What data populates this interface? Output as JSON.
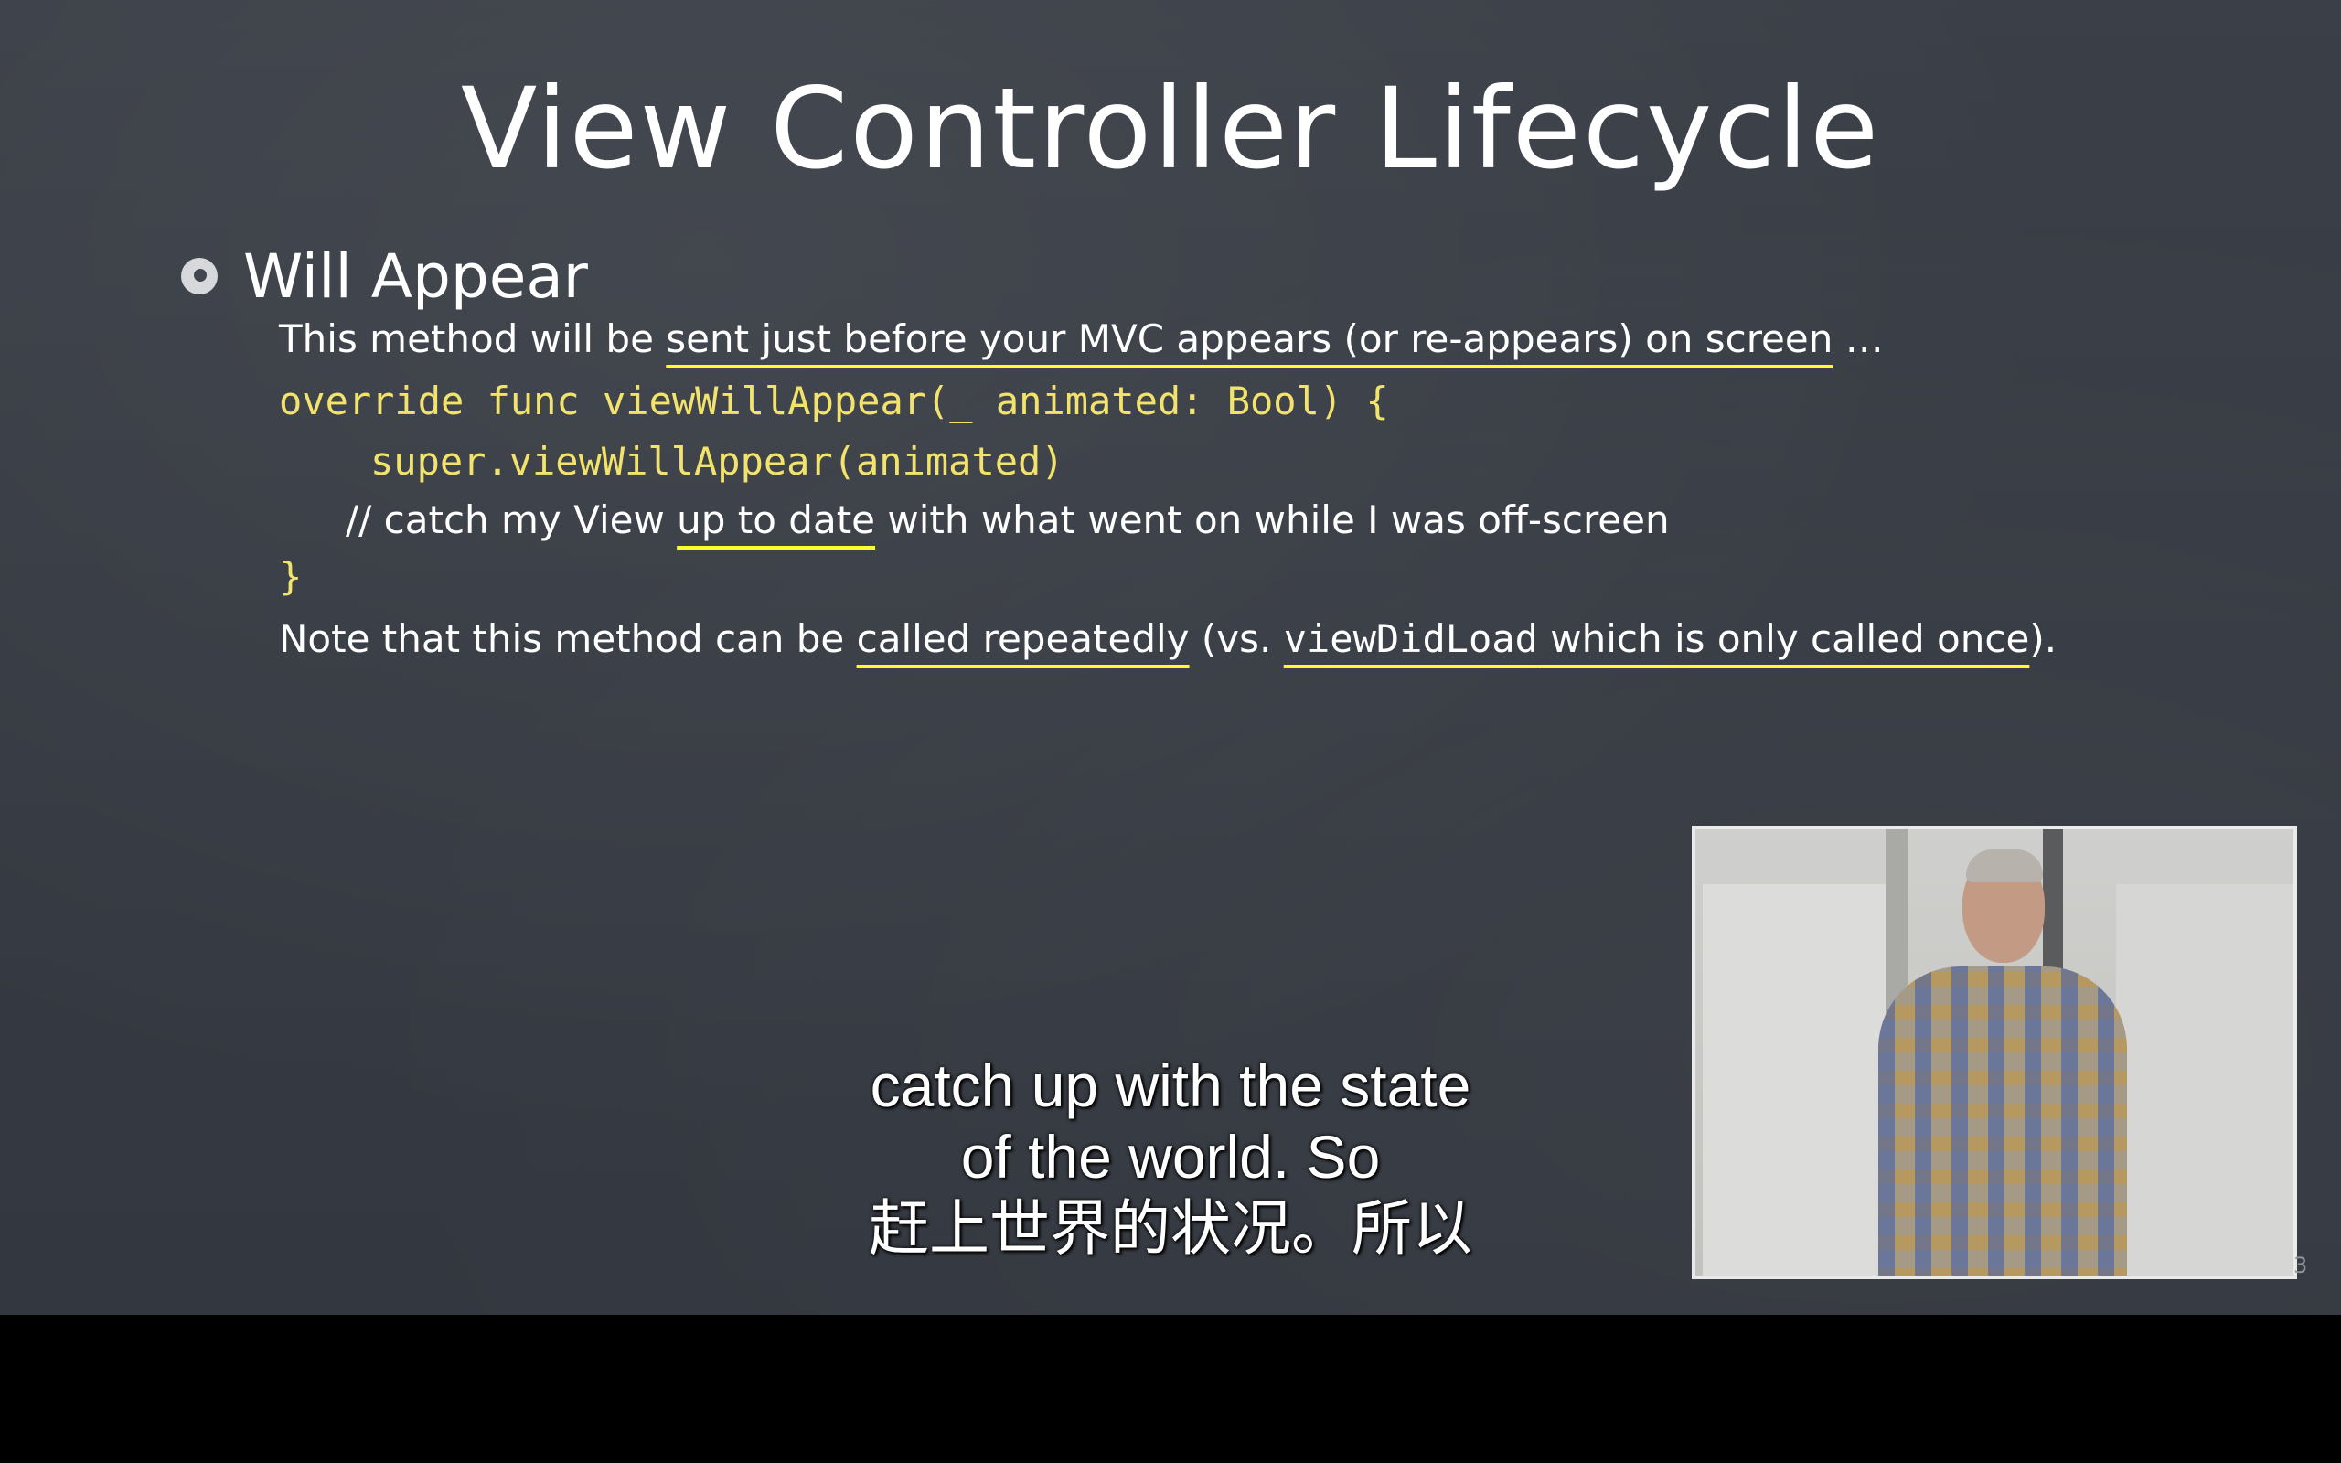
{
  "slide": {
    "title": "View Controller Lifecycle",
    "bullet": "Will Appear",
    "line1": {
      "prefix": "This method will be ",
      "underlined": "sent just before your MVC appears (or re-appears) on screen",
      "suffix": " …"
    },
    "code_signature": "override func viewWillAppear(_ animated: Bool) {",
    "code_super": "super.viewWillAppear(animated)",
    "comment": {
      "prefix": "// catch my View ",
      "underlined": "up to date",
      "suffix": " with what went on while I was off-screen"
    },
    "code_close": "}",
    "note": {
      "prefix": "Note that this method can be ",
      "underlined1": "called repeatedly",
      "middle": " (vs. ",
      "code_word": "viewDidLoad",
      "underlined2_rest": " which is only called once",
      "suffix": ")."
    },
    "page_marker": "3"
  },
  "subtitles": {
    "line1": "catch up with the state",
    "line2": "of the world. So",
    "line3": "赶上世界的状况。所以"
  },
  "colors": {
    "chalkboard": "#3b3f47",
    "code_yellow": "#f2e36c",
    "underline_yellow": "#ffff2a",
    "text_white": "#ffffff"
  }
}
